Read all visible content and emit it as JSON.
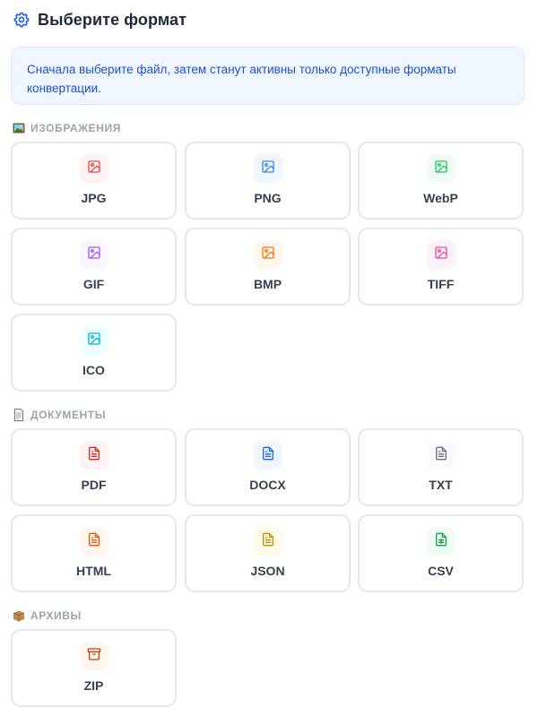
{
  "header": {
    "title": "Выберите формат",
    "icon": "gear-icon"
  },
  "notice": {
    "text": "Сначала выберите файл, затем станут активны только доступные форматы конвертации."
  },
  "colors": {
    "accent": "#2563eb",
    "jpg": "#ef4444",
    "png": "#3b82f6",
    "webp": "#22c55e",
    "gif": "#a855f7",
    "bmp": "#f97316",
    "tiff": "#ec4899",
    "ico": "#06b6d4",
    "pdf": "#dc2626",
    "docx": "#2563eb",
    "txt": "#6b7280",
    "html": "#ea580c",
    "json": "#ca8a04",
    "csv": "#16a34a",
    "zip": "#c2410c"
  },
  "sections": {
    "images": {
      "icon": "picture-emoji-icon",
      "label": "ИЗОБРАЖЕНИЯ",
      "formats": [
        "JPG",
        "PNG",
        "WebP",
        "GIF",
        "BMP",
        "TIFF",
        "ICO"
      ]
    },
    "documents": {
      "icon": "page-emoji-icon",
      "label": "ДОКУМЕНТЫ",
      "formats": [
        "PDF",
        "DOCX",
        "TXT",
        "HTML",
        "JSON",
        "CSV"
      ]
    },
    "archives": {
      "icon": "box-emoji-icon",
      "label": "АРХИВЫ",
      "formats": [
        "ZIP"
      ]
    }
  }
}
